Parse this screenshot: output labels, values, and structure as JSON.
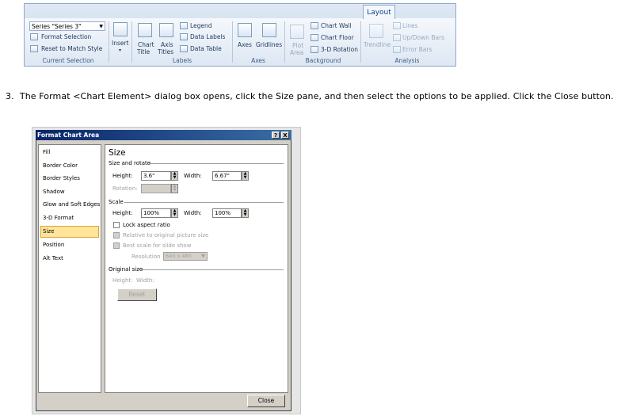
{
  "ribbon": {
    "tab_label": "Layout",
    "current_selection": {
      "combo_value": "Series \"Series 3\"",
      "format_selection": "Format Selection",
      "reset": "Reset to Match Style",
      "group_label": "Current Selection"
    },
    "insert_label": "Insert",
    "labels": {
      "chart_title": "Chart",
      "chart_title_2": "Title",
      "axis_titles": "Axis",
      "axis_titles_2": "Titles",
      "legend": "Legend",
      "data_labels": "Data Labels",
      "data_table": "Data Table",
      "group_label": "Labels"
    },
    "axes": {
      "axes": "Axes",
      "gridlines": "Gridlines",
      "group_label": "Axes"
    },
    "background": {
      "plot_area": "Plot",
      "plot_area_2": "Area",
      "chart_wall": "Chart Wall",
      "chart_floor": "Chart Floor",
      "rotation": "3-D Rotation",
      "group_label": "Background"
    },
    "analysis": {
      "trendline": "Trendline",
      "lines": "Lines",
      "updown": "Up/Down Bars",
      "error_bars": "Error Bars",
      "group_label": "Analysis"
    }
  },
  "instruction": {
    "number": "3.",
    "text": "The Format <Chart Element> dialog box opens, click the Size pane, and then select the options to be applied. Click the Close button."
  },
  "dialog": {
    "title": "Format Chart Area",
    "help_btn": "?",
    "close_x": "X",
    "nav": [
      "Fill",
      "Border Color",
      "Border Styles",
      "Shadow",
      "Glow and Soft Edges",
      "3-D Format",
      "Size",
      "Position",
      "Alt Text"
    ],
    "selected_index": 6,
    "pane_title": "Size",
    "size_rotate": {
      "section": "Size and rotate",
      "height_label": "Height:",
      "height_value": "3.6\"",
      "width_label": "Width:",
      "width_value": "6.67\"",
      "rotation_label": "Rotation:"
    },
    "scale": {
      "section": "Scale",
      "height_label": "Height:",
      "height_value": "100%",
      "width_label": "Width:",
      "width_value": "100%",
      "lock": "Lock aspect ratio",
      "relative": "Relative to original picture size",
      "best_scale": "Best scale for slide show",
      "resolution_label": "Resolution",
      "resolution_value": "640 x 480"
    },
    "original": {
      "section": "Original size",
      "height_label": "Height:",
      "width_label": "Width:",
      "reset": "Reset"
    },
    "close_button": "Close"
  }
}
